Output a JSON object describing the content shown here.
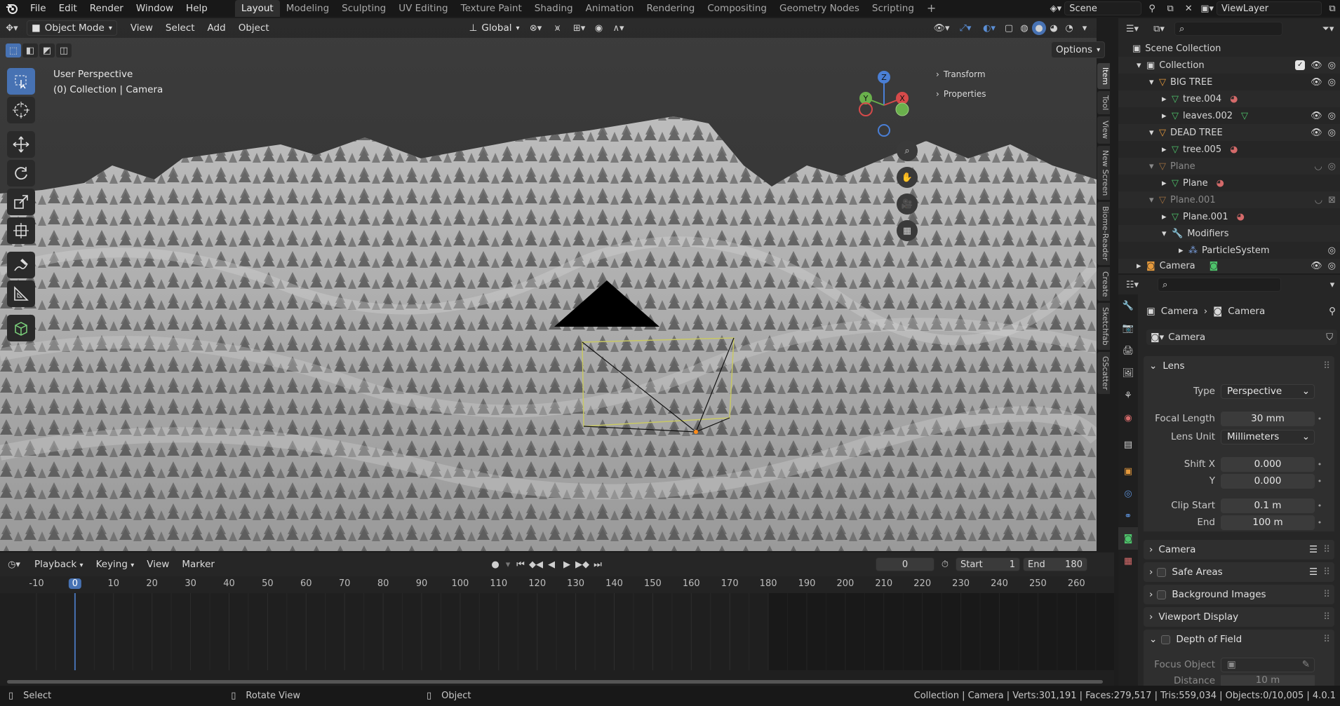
{
  "menu": {
    "items": [
      "File",
      "Edit",
      "Render",
      "Window",
      "Help"
    ],
    "workspaces": [
      "Layout",
      "Modeling",
      "Sculpting",
      "UV Editing",
      "Texture Paint",
      "Shading",
      "Animation",
      "Rendering",
      "Compositing",
      "Geometry Nodes",
      "Scripting"
    ],
    "active_workspace": "Layout",
    "scene": "Scene",
    "view_layer": "ViewLayer"
  },
  "viewport": {
    "mode": "Object Mode",
    "menus": [
      "View",
      "Select",
      "Add",
      "Object"
    ],
    "orientation": "Global",
    "options_label": "Options",
    "overlay_title": "User Perspective",
    "overlay_subtitle": "(0) Collection | Camera",
    "npanel": {
      "transform": "Transform",
      "properties": "Properties"
    },
    "side_tabs": [
      "Item",
      "Tool",
      "View",
      "New Screen",
      "Biome-Reader",
      "Create",
      "Sketchfab",
      "GScatter"
    ],
    "gizmo": {
      "z": "Z",
      "y": "Y",
      "x": "X"
    }
  },
  "timeline": {
    "menus": [
      "Playback",
      "Keying",
      "View",
      "Marker"
    ],
    "current_frame": "0",
    "start_label": "Start",
    "start": "1",
    "end_label": "End",
    "end": "180",
    "ticks": [
      "-10",
      "0",
      "10",
      "20",
      "30",
      "40",
      "50",
      "60",
      "70",
      "80",
      "90",
      "100",
      "110",
      "120",
      "130",
      "140",
      "150",
      "160",
      "170",
      "180",
      "190",
      "200",
      "210",
      "220",
      "230",
      "240",
      "250",
      "260"
    ]
  },
  "status": {
    "select": "Select",
    "rotate": "Rotate View",
    "object": "Object",
    "info": "Collection | Camera | Verts:301,191 | Faces:279,517 | Tris:559,034 | Objects:0/10,005 | 4.0.1"
  },
  "outliner": {
    "scene_collection": "Scene Collection",
    "rows": [
      {
        "label": "Collection"
      },
      {
        "label": "BIG TREE"
      },
      {
        "label": "tree.004"
      },
      {
        "label": "leaves.002"
      },
      {
        "label": "DEAD TREE"
      },
      {
        "label": "tree.005"
      },
      {
        "label": "Plane"
      },
      {
        "label": "Plane"
      },
      {
        "label": "Plane.001"
      },
      {
        "label": "Plane.001"
      },
      {
        "label": "Modifiers"
      },
      {
        "label": "ParticleSystem"
      },
      {
        "label": "Camera"
      }
    ]
  },
  "properties": {
    "breadcrumb_object": "Camera",
    "breadcrumb_data": "Camera",
    "datablock": "Camera",
    "lens_panel": "Lens",
    "type_label": "Type",
    "type_value": "Perspective",
    "focal_label": "Focal Length",
    "focal_value": "30 mm",
    "lens_unit_label": "Lens Unit",
    "lens_unit_value": "Millimeters",
    "shift_x_label": "Shift X",
    "shift_x_value": "0.000",
    "shift_y_label": "Y",
    "shift_y_value": "0.000",
    "clip_start_label": "Clip Start",
    "clip_start_value": "0.1 m",
    "clip_end_label": "End",
    "clip_end_value": "100 m",
    "camera_panel": "Camera",
    "safe_areas_panel": "Safe Areas",
    "bg_images_panel": "Background Images",
    "viewport_display_panel": "Viewport Display",
    "dof_panel": "Depth of Field",
    "focus_object_label": "Focus Object",
    "distance_label": "Distance",
    "distance_value": "10 m"
  }
}
